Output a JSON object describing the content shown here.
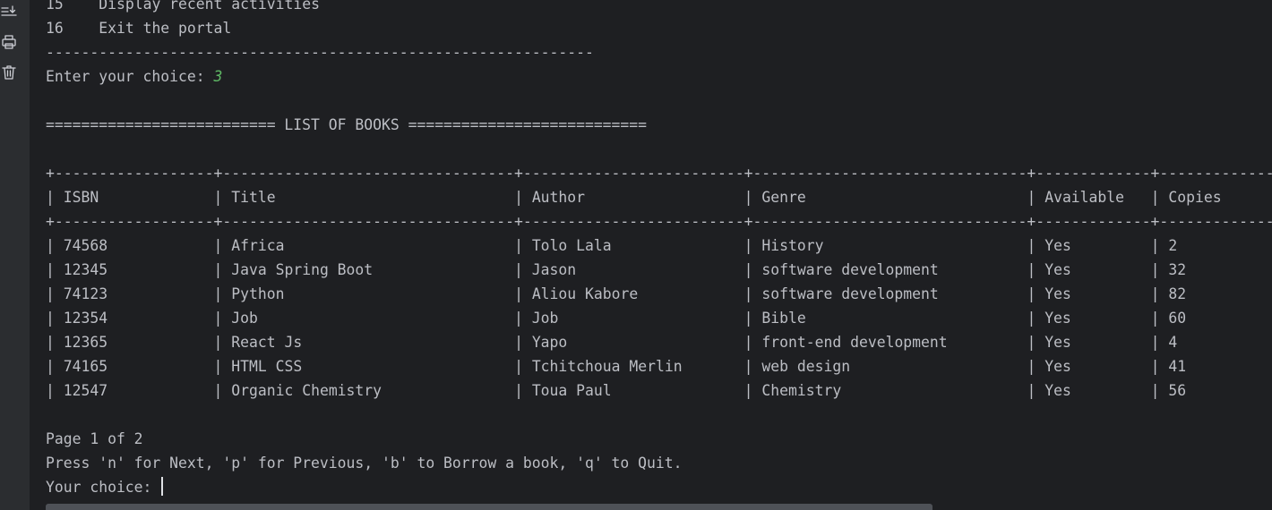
{
  "menu": [
    {
      "num": "15",
      "label": "Display recent activities"
    },
    {
      "num": "16",
      "label": "Exit the portal"
    }
  ],
  "separator": "--------------------------------------------------------------",
  "prompt": {
    "label": "Enter your choice: ",
    "value": "3"
  },
  "list_title": "========================== LIST OF BOOKS ===========================",
  "table": {
    "widths": [
      18,
      33,
      25,
      31,
      13,
      13
    ],
    "columns": [
      "ISBN",
      "Title",
      "Author",
      "Genre",
      "Available",
      "Copies"
    ],
    "rows": [
      [
        "74568",
        "Africa",
        "Tolo Lala",
        "History",
        "Yes",
        "2"
      ],
      [
        "12345",
        "Java Spring Boot",
        "Jason",
        "software development",
        "Yes",
        "32"
      ],
      [
        "74123",
        "Python",
        "Aliou Kabore",
        "software development",
        "Yes",
        "82"
      ],
      [
        "12354",
        "Job",
        "Job",
        "Bible",
        "Yes",
        "60"
      ],
      [
        "12365",
        "React Js",
        "Yapo",
        "front-end development",
        "Yes",
        "4"
      ],
      [
        "74165",
        "HTML CSS",
        "Tchitchoua Merlin",
        "web design",
        "Yes",
        "41"
      ],
      [
        "12547",
        "Organic Chemistry",
        "Toua Paul",
        "Chemistry",
        "Yes",
        "56"
      ]
    ]
  },
  "pagination": "Page 1 of 2",
  "instructions": "Press 'n' for Next, 'p' for Previous, 'b' to Borrow a book, 'q' to Quit.",
  "final_prompt": "Your choice: ",
  "gutter_icons": [
    "scroll-to-end-icon",
    "print-icon",
    "clear-all-icon"
  ],
  "colors": {
    "input_accent": "#5fb865",
    "text": "#bcbec4",
    "background": "#1e1f22"
  }
}
